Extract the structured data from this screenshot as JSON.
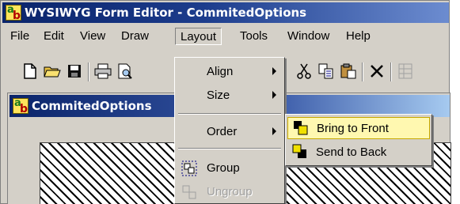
{
  "window": {
    "title": "WYSIWYG Form Editor - CommitedOptions",
    "app_icon_text": "ab"
  },
  "menubar": {
    "items": [
      {
        "label": "File"
      },
      {
        "label": "Edit"
      },
      {
        "label": "View"
      },
      {
        "label": "Draw"
      },
      {
        "label": "Layout"
      },
      {
        "label": "Tools"
      },
      {
        "label": "Window"
      },
      {
        "label": "Help"
      }
    ],
    "open_item": "Layout"
  },
  "toolbar": {
    "buttons": [
      "new-file-icon",
      "open-folder-icon",
      "save-icon",
      "print-icon",
      "print-preview-icon",
      "cut-icon",
      "copy-icon",
      "paste-icon",
      "delete-icon"
    ]
  },
  "child_window": {
    "title": "CommitedOptions"
  },
  "layout_menu": {
    "align": "Align",
    "size": "Size",
    "order": "Order",
    "group": "Group",
    "ungroup": "Ungroup"
  },
  "order_submenu": {
    "bring_to_front": "Bring to Front",
    "send_to_back": "Send to Back"
  },
  "colors": {
    "title_bar": "#0a246a",
    "menu_face": "#d4d0c8",
    "highlight": "#fff8b0"
  }
}
